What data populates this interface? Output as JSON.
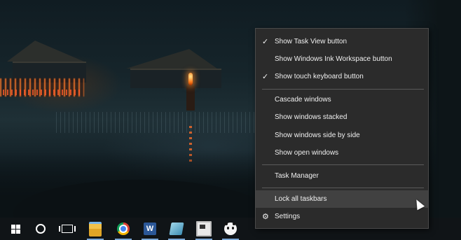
{
  "context_menu": {
    "items": [
      {
        "label": "Show Task View button",
        "checked": true
      },
      {
        "label": "Show Windows Ink Workspace button",
        "checked": false
      },
      {
        "label": "Show touch keyboard button",
        "checked": true
      },
      {
        "label": "Cascade windows",
        "checked": false
      },
      {
        "label": "Show windows stacked",
        "checked": false
      },
      {
        "label": "Show windows side by side",
        "checked": false
      },
      {
        "label": "Show open windows",
        "checked": false
      },
      {
        "label": "Task Manager",
        "checked": false
      },
      {
        "label": "Lock all taskbars",
        "checked": false,
        "hovered": true
      },
      {
        "label": "Settings",
        "icon": "gear-icon"
      }
    ],
    "check_glyph": "✓",
    "gear_glyph": "⚙",
    "background_color": "#2b2b2b",
    "hover_color": "#414141"
  },
  "taskbar": {
    "background_color": "#101417",
    "items": [
      {
        "name": "start",
        "icon": "windows-logo-icon"
      },
      {
        "name": "cortana",
        "icon": "cortana-circle-icon"
      },
      {
        "name": "task-view",
        "icon": "task-view-icon"
      },
      {
        "name": "file-explorer",
        "icon": "folder-icon",
        "running": true
      },
      {
        "name": "chrome",
        "icon": "chrome-icon",
        "running": true
      },
      {
        "name": "word",
        "icon": "word-icon",
        "running": true,
        "glyph": "W"
      },
      {
        "name": "notes",
        "icon": "notes-icon",
        "running": true
      },
      {
        "name": "monitor-app",
        "icon": "monitor-icon",
        "running": true
      },
      {
        "name": "panda-app",
        "icon": "panda-icon",
        "running": true
      }
    ]
  }
}
